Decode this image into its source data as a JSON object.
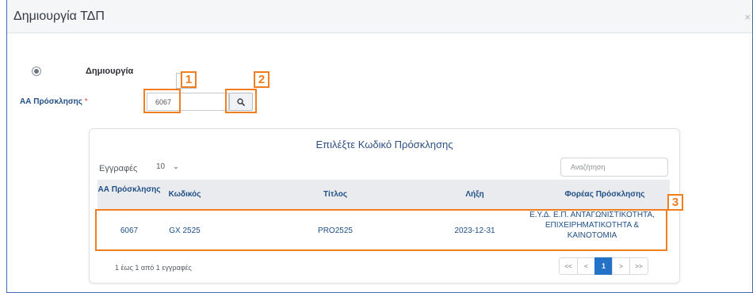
{
  "modal": {
    "title": "Δημιουργία ΤΔΠ",
    "close": "×"
  },
  "form": {
    "radio_label": "Δημιουργία",
    "field_label": "ΑΑ Πρόσκλησης",
    "required_mark": "*",
    "call_number_value": "6067"
  },
  "panel": {
    "title": "Επιλέξτε Κωδικό Πρόσκλησης",
    "show_label": "Εγγραφές",
    "page_length": "10",
    "search_placeholder": "Αναζήτηση",
    "columns": [
      "ΑΑ Πρόσκλησης",
      "Κωδικός",
      "Τίτλος",
      "Λήξη",
      "Φορέας Πρόσκλησης"
    ],
    "rows": [
      {
        "aa": "6067",
        "code": "GX 2525",
        "title": "PRO2525",
        "expiry": "2023-12-31",
        "body_line1": "Ε.Υ.Δ. Ε.Π. ΑΝΤΑΓΩΝΙΣΤΙΚΟΤΗΤΑ,",
        "body_line2": "ΕΠΙΧΕΙΡΗΜΑΤΙΚΟΤΗΤΑ &",
        "body_line3": "ΚΑΙΝΟΤΟΜΙΑ"
      }
    ],
    "info": "1 έως 1 από 1 εγγραφές",
    "pager": {
      "first": "<<",
      "prev": "<",
      "current": "1",
      "next": ">",
      "last": ">>"
    }
  },
  "annotations": {
    "badge1": "1",
    "badge2": "2",
    "badge3": "3",
    "color": "#f07d1e"
  },
  "colors": {
    "accent": "#2472c8",
    "label_blue": "#1f4f86",
    "header_bg": "#e9ebee"
  }
}
